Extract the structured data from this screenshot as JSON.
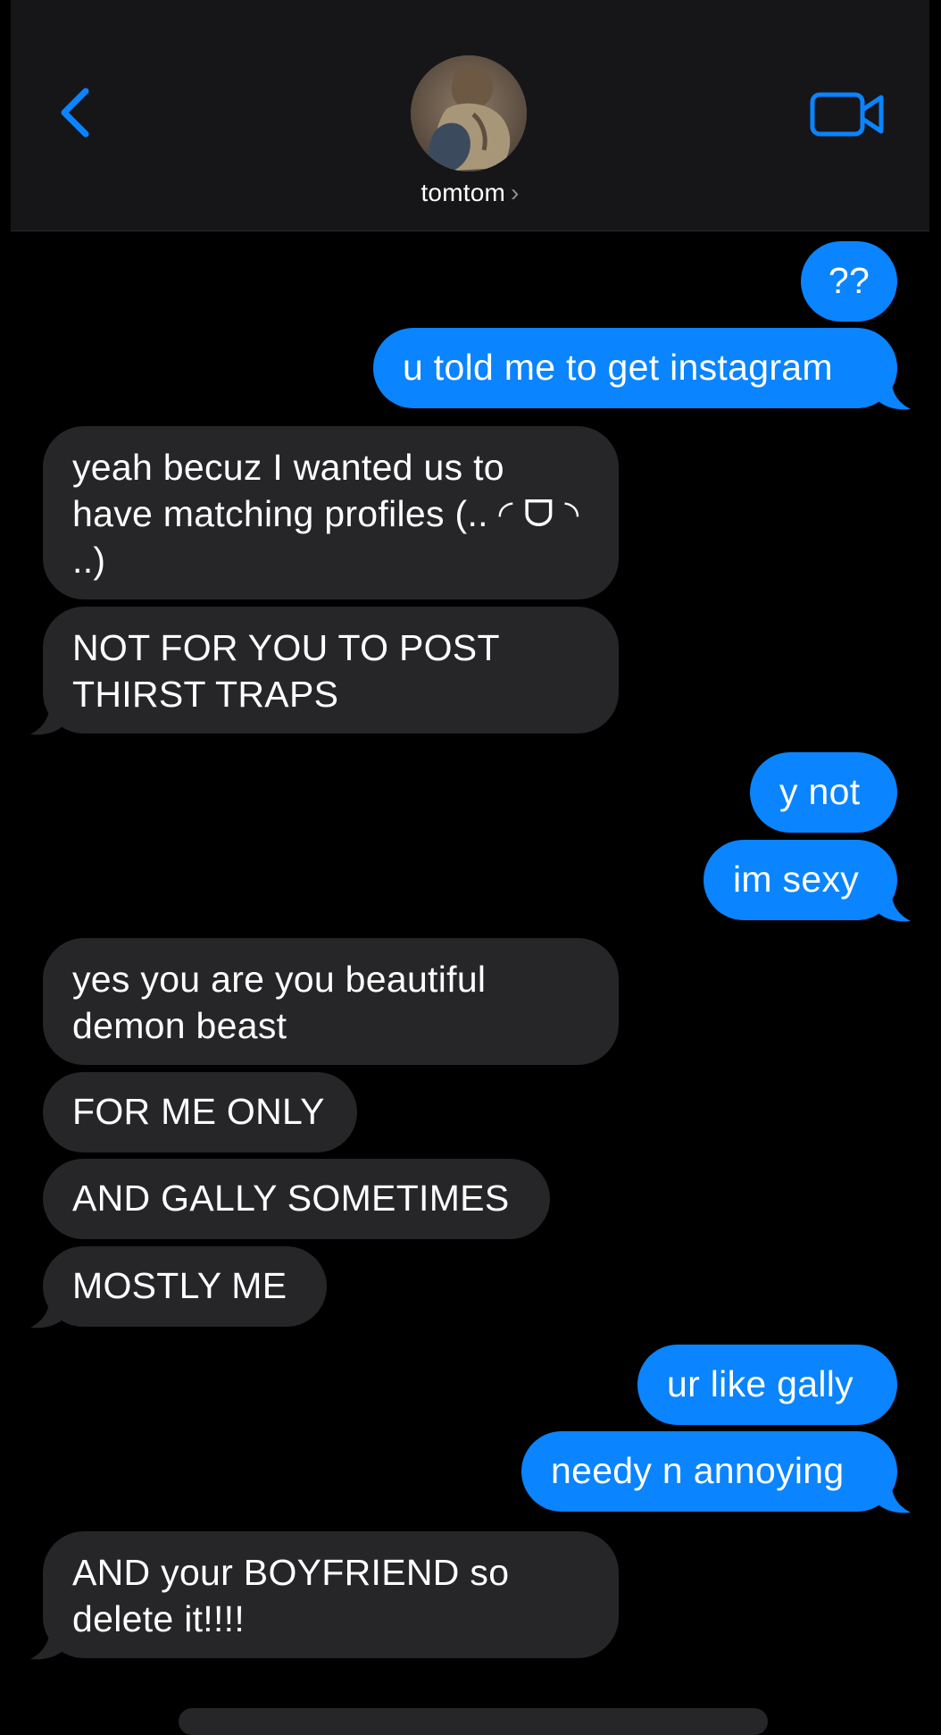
{
  "header": {
    "contact_name": "tomtom",
    "chevron": "›",
    "back_icon": "chevron-left-icon",
    "video_icon": "video-camera-icon",
    "accent_color": "#0a84ff"
  },
  "messages": [
    {
      "side": "out",
      "text": "??"
    },
    {
      "side": "out",
      "text": "u told me to get instagram"
    },
    {
      "side": "in",
      "text": "yeah becuz I wanted us to have matching profiles (.. ◜ ᗜ ◝ ..)"
    },
    {
      "side": "in",
      "text": "NOT FOR YOU TO POST THIRST TRAPS"
    },
    {
      "side": "out",
      "text": "y not"
    },
    {
      "side": "out",
      "text": "im sexy"
    },
    {
      "side": "in",
      "text": "yes you are you beautiful demon beast"
    },
    {
      "side": "in",
      "text": "FOR ME ONLY"
    },
    {
      "side": "in",
      "text": "AND GALLY SOMETIMES"
    },
    {
      "side": "in",
      "text": "MOSTLY ME"
    },
    {
      "side": "out",
      "text": "ur like gally"
    },
    {
      "side": "out",
      "text": "needy n annoying"
    },
    {
      "side": "in",
      "text": "AND your BOYFRIEND so delete it!!!!"
    }
  ]
}
